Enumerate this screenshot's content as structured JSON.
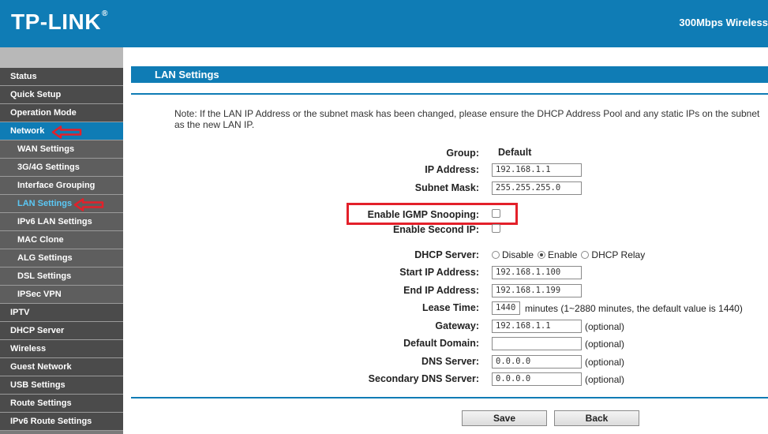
{
  "header": {
    "logo": "TP-LINK",
    "logo_mark": "®",
    "model": "300Mbps Wireless",
    "brand_color": "#0f7cb5"
  },
  "sidebar": {
    "items": [
      {
        "label": "Status",
        "level": 0
      },
      {
        "label": "Quick Setup",
        "level": 0
      },
      {
        "label": "Operation Mode",
        "level": 0
      },
      {
        "label": "Network",
        "level": 0,
        "state": "expanded"
      },
      {
        "label": "WAN Settings",
        "level": 1
      },
      {
        "label": "3G/4G Settings",
        "level": 1
      },
      {
        "label": "Interface Grouping",
        "level": 1
      },
      {
        "label": "LAN Settings",
        "level": 1,
        "state": "selected"
      },
      {
        "label": "IPv6 LAN Settings",
        "level": 1
      },
      {
        "label": "MAC Clone",
        "level": 1
      },
      {
        "label": "ALG Settings",
        "level": 1
      },
      {
        "label": "DSL Settings",
        "level": 1
      },
      {
        "label": "IPSec VPN",
        "level": 1
      },
      {
        "label": "IPTV",
        "level": 0
      },
      {
        "label": "DHCP Server",
        "level": 0
      },
      {
        "label": "Wireless",
        "level": 0
      },
      {
        "label": "Guest Network",
        "level": 0
      },
      {
        "label": "USB Settings",
        "level": 0
      },
      {
        "label": "Route Settings",
        "level": 0
      },
      {
        "label": "IPv6 Route Settings",
        "level": 0
      }
    ]
  },
  "main": {
    "title": "LAN Settings",
    "note": "Note: If the LAN IP Address or the subnet mask has been changed, please ensure the DHCP Address Pool and any static IPs on the subnet as the new LAN IP.",
    "group": {
      "label": "Group:",
      "value": "Default"
    },
    "ip_address": {
      "label": "IP Address:",
      "value": "192.168.1.1"
    },
    "subnet_mask": {
      "label": "Subnet Mask:",
      "value": "255.255.255.0"
    },
    "igmp_snooping": {
      "label": "Enable IGMP Snooping:",
      "checked": false
    },
    "second_ip": {
      "label": "Enable Second IP:",
      "checked": false
    },
    "dhcp_server": {
      "label": "DHCP Server:",
      "options": [
        "Disable",
        "Enable",
        "DHCP Relay"
      ],
      "selected": "Enable"
    },
    "start_ip": {
      "label": "Start IP Address:",
      "value": "192.168.1.100"
    },
    "end_ip": {
      "label": "End IP Address:",
      "value": "192.168.1.199"
    },
    "lease_time": {
      "label": "Lease Time:",
      "value": "1440",
      "hint": "minutes (1~2880 minutes, the default value is 1440)"
    },
    "gateway": {
      "label": "Gateway:",
      "value": "192.168.1.1",
      "hint": "(optional)"
    },
    "default_domain": {
      "label": "Default Domain:",
      "value": "",
      "hint": "(optional)"
    },
    "dns_server": {
      "label": "DNS Server:",
      "value": "0.0.0.0",
      "hint": "(optional)"
    },
    "secondary_dns": {
      "label": "Secondary DNS Server:",
      "value": "0.0.0.0",
      "hint": "(optional)"
    },
    "save_label": "Save",
    "back_label": "Back"
  },
  "annotations": {
    "highlight_color": "#e3202a"
  }
}
